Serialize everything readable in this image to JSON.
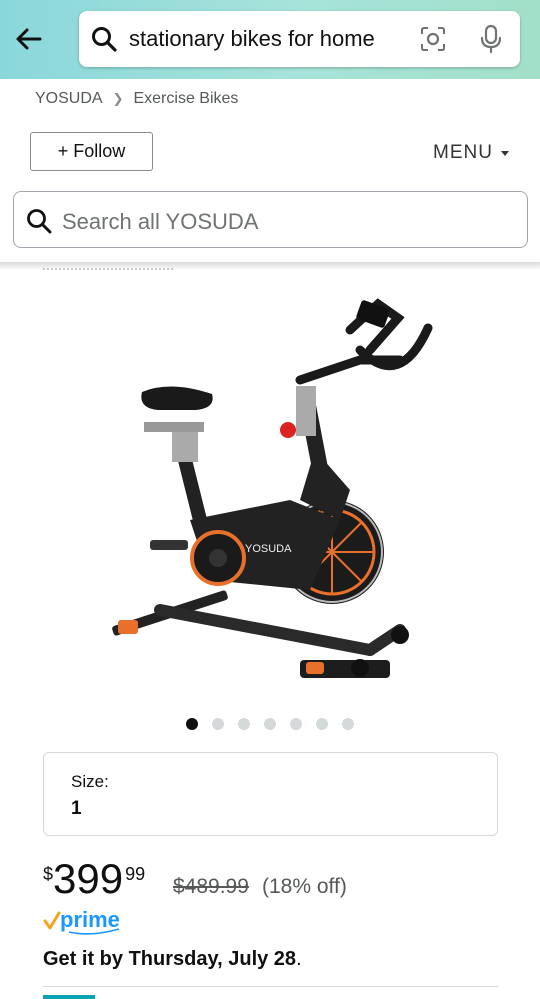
{
  "header": {
    "search_query": "stationary bikes for home",
    "icons": [
      "back-arrow-icon",
      "search-icon",
      "camera-scan-icon",
      "microphone-icon"
    ]
  },
  "breadcrumb": {
    "brand": "YOSUDA",
    "category": "Exercise Bikes"
  },
  "store": {
    "follow_label": "+ Follow",
    "menu_label": "MENU",
    "search_placeholder": "Search all YOSUDA"
  },
  "product": {
    "image_alt": "YOSUDA exercise bike",
    "brand_on_frame": "YOSUDA",
    "carousel": {
      "count": 7,
      "active_index": 0
    },
    "size_label": "Size:",
    "size_value": "1",
    "price": {
      "currency": "$",
      "whole": "399",
      "fraction": "99"
    },
    "list_price": "$489.99",
    "discount": "(18% off)",
    "prime_label": "prime",
    "delivery_prefix": "Get it by ",
    "delivery_date": "Thursday, July 28",
    "delivery_suffix": "."
  },
  "colors": {
    "accent_teal": "#0aa3b3",
    "prime_blue": "#1a98ff",
    "prime_orange": "#f7a41d",
    "bike_orange": "#e8702a"
  }
}
